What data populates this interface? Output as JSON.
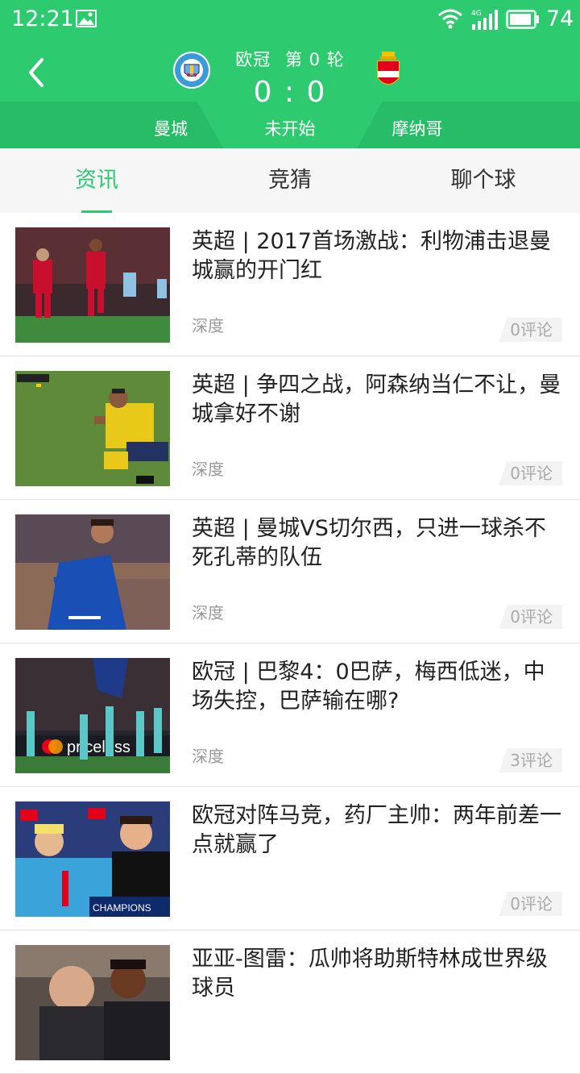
{
  "status_bar": {
    "time": "12:21",
    "network": "4G",
    "battery": "74",
    "icons": [
      "image-icon",
      "wifi-icon",
      "signal-icon",
      "battery-icon"
    ]
  },
  "match": {
    "competition": "欧冠",
    "round": "第 0 轮",
    "score": "0 : 0",
    "status": "未开始",
    "home_team": "曼城",
    "away_team": "摩纳哥",
    "home_badge_text": "MANCHESTER CITY",
    "accent_color": "#2dca70"
  },
  "tabs": [
    {
      "label": "资讯",
      "active": true
    },
    {
      "label": "竞猜",
      "active": false
    },
    {
      "label": "聊个球",
      "active": false
    }
  ],
  "news": [
    {
      "title": "英超 | 2017首场激战：利物浦击退曼城赢的开门红",
      "tag": "深度",
      "comments": "0评论"
    },
    {
      "title": "英超 | 争四之战，阿森纳当仁不让，曼城拿好不谢",
      "tag": "深度",
      "comments": "0评论"
    },
    {
      "title": "英超 | 曼城VS切尔西，只进一球杀不死孔蒂的队伍",
      "tag": "深度",
      "comments": "0评论"
    },
    {
      "title": "欧冠 | 巴黎4：0巴萨，梅西低迷，中场失控，巴萨输在哪?",
      "tag": "深度",
      "comments": "3评论"
    },
    {
      "title": "欧冠对阵马竞，药厂主帅：两年前差一点就赢了",
      "tag": "",
      "comments": "0评论"
    },
    {
      "title": "亚亚-图雷：瓜帅将助斯特林成世界级球员",
      "tag": "",
      "comments": ""
    }
  ],
  "thumbnail_text": {
    "sponsor": "priceless",
    "champions": "CHAMPIONS"
  }
}
